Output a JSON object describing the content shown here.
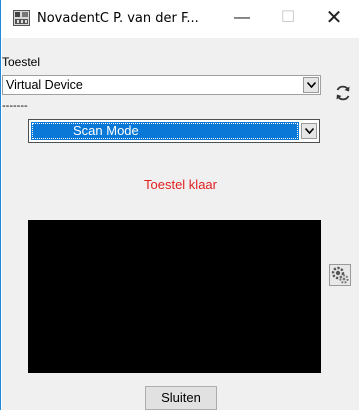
{
  "window": {
    "title": "NovadentC P. van der F...",
    "minimize_glyph": "—",
    "maximize_glyph": "☐",
    "close_glyph": "✕"
  },
  "device": {
    "label": "Toestel",
    "selected": "Virtual Device",
    "refresh_icon": "refresh-icon"
  },
  "separator": {
    "text": "-------"
  },
  "mode": {
    "selected": "Scan Mode"
  },
  "status": {
    "text": "Toestel klaar",
    "color": "#e02020"
  },
  "buttons": {
    "close_label": "Sluiten",
    "settings_icon": "gear-icon"
  },
  "colors": {
    "accent": "#0a78d7",
    "window_border": "#1e88d9",
    "preview_bg": "#000000"
  }
}
